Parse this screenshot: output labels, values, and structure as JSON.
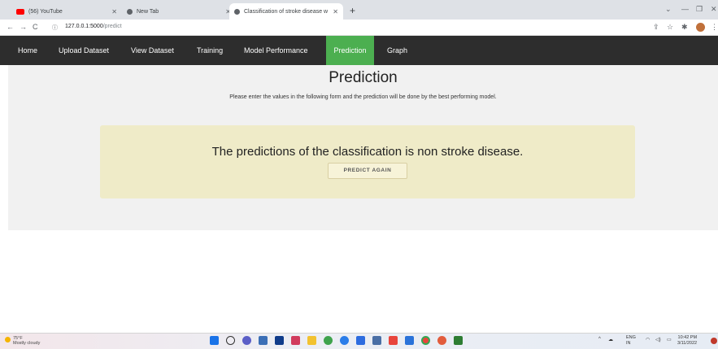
{
  "browser": {
    "tabs": [
      {
        "title": "(56) YouTube",
        "active": false
      },
      {
        "title": "New Tab",
        "active": false
      },
      {
        "title": "Classification of stroke disease w",
        "active": true
      }
    ],
    "new_tab_label": "+",
    "url_host": "127.0.0.1:5000",
    "url_path": "/predict"
  },
  "nav": {
    "items": [
      "Home",
      "Upload Dataset",
      "View Dataset",
      "Training",
      "Model Performance",
      "Prediction",
      "Graph"
    ],
    "active": "Prediction"
  },
  "page": {
    "title": "Prediction",
    "subtitle": "Please enter the values in the following form and the prediction will be done by the best performing model.",
    "result_text": "The predictions of the classification is non stroke disease.",
    "predict_again_label": "PREDICT AGAIN"
  },
  "taskbar": {
    "weather_temp": "75°F",
    "weather_desc": "Mostly cloudy",
    "lang": "ENG",
    "region": "IN",
    "time": "10:42 PM",
    "date": "3/11/2022"
  },
  "colors": {
    "nav_bg": "#2d2d2d",
    "nav_active": "#4caf50",
    "card_bg": "#efebc8",
    "main_bg": "#f1f1f1"
  }
}
